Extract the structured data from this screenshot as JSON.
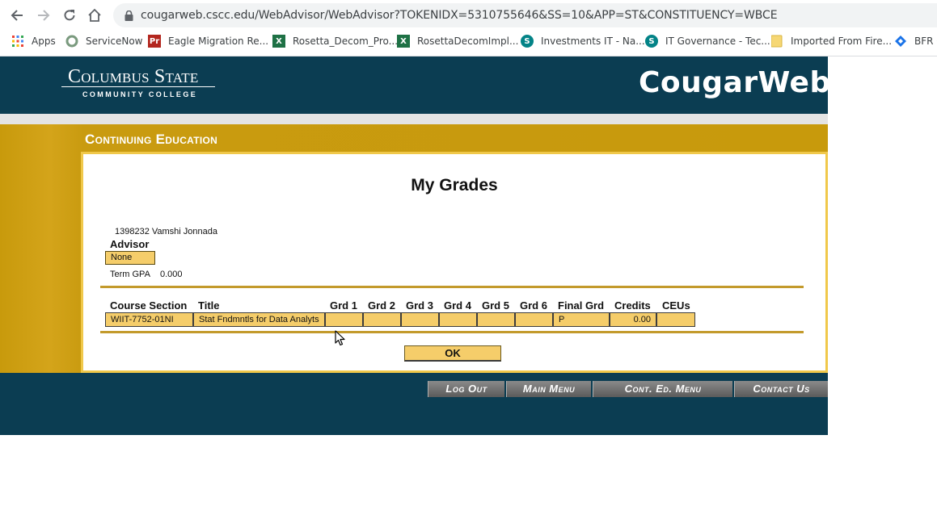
{
  "browser": {
    "url": "cougarweb.cscc.edu/WebAdvisor/WebAdvisor?TOKENIDX=5310755646&SS=10&APP=ST&CONSTITUENCY=WBCE",
    "bookmarks": [
      {
        "label": "Apps",
        "icon": "apps-grid-icon"
      },
      {
        "label": "ServiceNow",
        "icon": "servicenow-icon"
      },
      {
        "label": "Eagle Migration Re...",
        "icon": "pdf-icon"
      },
      {
        "label": "Rosetta_Decom_Pro...",
        "icon": "excel-icon"
      },
      {
        "label": "RosettaDecomImpl...",
        "icon": "excel-icon"
      },
      {
        "label": "Investments IT - Na...",
        "icon": "sharepoint-icon"
      },
      {
        "label": "IT Governance - Tec...",
        "icon": "sharepoint-icon"
      },
      {
        "label": "Imported From Fire...",
        "icon": "folder-icon"
      },
      {
        "label": "BFR G",
        "icon": "diamond-icon"
      }
    ]
  },
  "header": {
    "logo_title": "Columbus State",
    "logo_subtitle": "COMMUNITY COLLEGE",
    "brand": "CougarWeb"
  },
  "section_title": "Continuing Education",
  "page_title": "My Grades",
  "student": "1398232 Vamshi Jonnada",
  "advisor": {
    "label": "Advisor",
    "value": "None"
  },
  "term_gpa": {
    "label": "Term GPA",
    "value": "0.000"
  },
  "grades_table": {
    "headers": [
      "Course Section",
      "Title",
      "Grd 1",
      "Grd 2",
      "Grd 3",
      "Grd 4",
      "Grd 5",
      "Grd 6",
      "Final Grd",
      "Credits",
      "CEUs"
    ],
    "rows": [
      [
        "WIIT-7752-01NI",
        "Stat Fndmntls for Data Analyts",
        "",
        "",
        "",
        "",
        "",
        "",
        "P",
        "0.00",
        ""
      ]
    ]
  },
  "ok_label": "OK",
  "footer_nav": [
    {
      "label": "Log Out"
    },
    {
      "label": "Main Menu"
    },
    {
      "label": "Cont. Ed. Menu"
    },
    {
      "label": "Contact Us"
    }
  ],
  "colors": {
    "navy": "#0b3d52",
    "gold": "#c89a0c",
    "cell_fill": "#f5cd6a"
  }
}
